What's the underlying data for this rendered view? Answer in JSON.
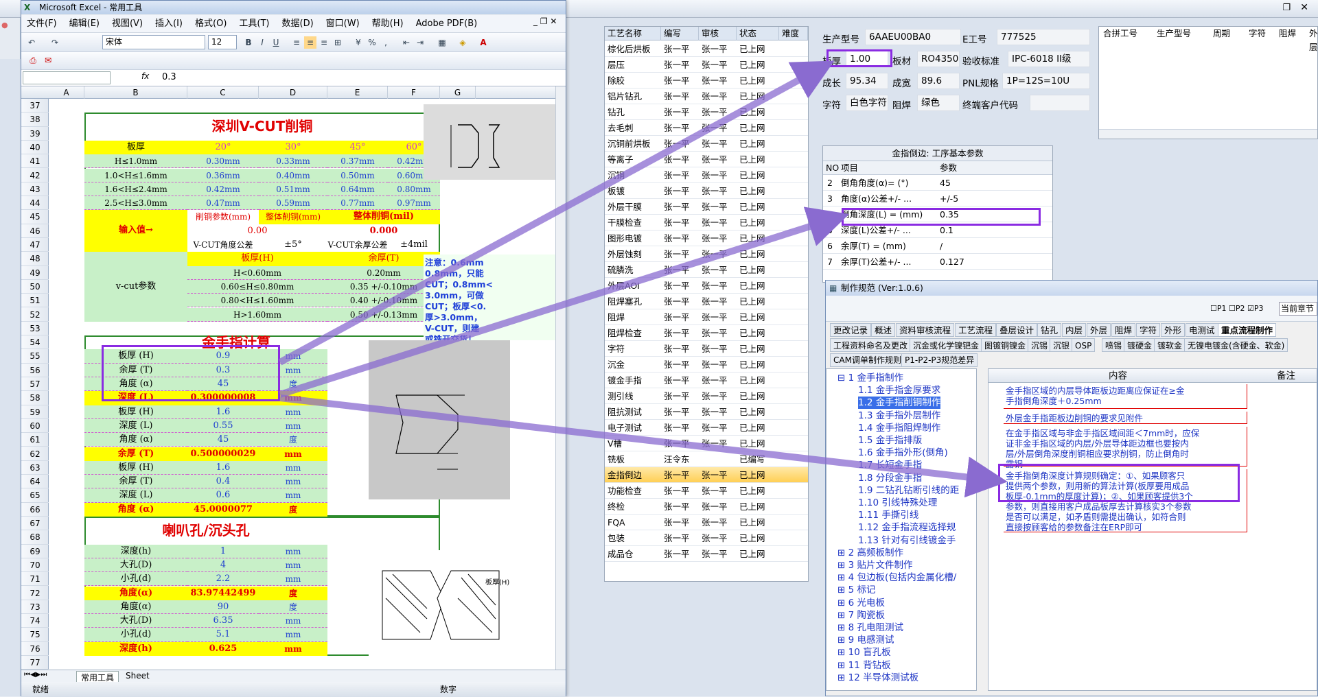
{
  "excel": {
    "title": "Microsoft Excel - 常用工具",
    "menus": [
      "文件(F)",
      "编辑(E)",
      "视图(V)",
      "插入(I)",
      "格式(O)",
      "工具(T)",
      "数据(D)",
      "窗口(W)",
      "帮助(H)",
      "Adobe PDF(B)"
    ],
    "font": "宋体",
    "font_size": "12",
    "fx": "fx",
    "formula_value": "0.3",
    "columns": [
      "A",
      "B",
      "C",
      "D",
      "E",
      "F",
      "G"
    ],
    "rows": [
      "37",
      "38",
      "39",
      "40",
      "41",
      "42",
      "43",
      "44",
      "45",
      "46",
      "47",
      "48",
      "49",
      "50",
      "51",
      "52",
      "53",
      "54",
      "55",
      "56",
      "57",
      "58",
      "59",
      "60",
      "61",
      "62",
      "63",
      "64",
      "65",
      "66",
      "67",
      "68",
      "69",
      "70",
      "71",
      "72",
      "73",
      "74",
      "75",
      "76",
      "77"
    ],
    "vcut": {
      "title": "深圳V-CUT削铜",
      "header": [
        "板厚",
        "20°",
        "30°",
        "45°",
        "60°"
      ],
      "rows": [
        [
          "H≤1.0mm",
          "0.30mm",
          "0.33mm",
          "0.37mm",
          "0.42mm"
        ],
        [
          "1.0<H≤1.6mm",
          "0.36mm",
          "0.40mm",
          "0.50mm",
          "0.60mm"
        ],
        [
          "1.6<H≤2.4mm",
          "0.42mm",
          "0.51mm",
          "0.64mm",
          "0.80mm"
        ],
        [
          "2.5<H≤3.0mm",
          "0.47mm",
          "0.59mm",
          "0.77mm",
          "0.97mm"
        ]
      ],
      "input_label": "输入值→",
      "param_hdr1": "削铜参数(mm)",
      "param_hdr2": "整体削铜(mm)",
      "param_hdr3": "整体削铜(mil)",
      "v1": "0.00",
      "v2": "0.000",
      "tol_label1": "V-CUT角度公差",
      "tol_value1": "±5°",
      "tol_label2": "V-CUT余厚公差",
      "tol_value2": "±4mil",
      "vcut_param_label": "v-cut参数",
      "vp_hdr1": "板厚(H)",
      "vp_hdr2": "余厚(T)",
      "vp_rows": [
        [
          "H<0.60mm",
          "0.20mm"
        ],
        [
          "0.60≤H≤0.80mm",
          "0.35 +/-0.10mm"
        ],
        [
          "0.80<H≤1.60mm",
          "0.40 +/-0.10mm"
        ],
        [
          "H>1.60mm",
          "0.50 +/-0.13mm"
        ]
      ],
      "note": "注意：0.6mm\n0.8mm，只能\nCUT；0.8mm<\n3.0mm，可做\nCUT；板厚<0.\n厚>3.0mm，\nV-CUT，则建\n或铣开交货！"
    },
    "gold": {
      "title": "金手指计算",
      "rows": [
        [
          "板厚 (H)",
          "0.9",
          "mm"
        ],
        [
          "余厚 (T)",
          "0.3",
          "mm"
        ],
        [
          "角度 (α)",
          "45",
          "度"
        ],
        [
          "深度 (L)",
          "0.300000008",
          "mm"
        ],
        [
          "板厚 (H)",
          "1.6",
          "mm"
        ],
        [
          "深度 (L)",
          "0.55",
          "mm"
        ],
        [
          "角度 (α)",
          "45",
          "度"
        ],
        [
          "余厚 (T)",
          "0.500000029",
          "mm"
        ],
        [
          "板厚 (H)",
          "1.6",
          "mm"
        ],
        [
          "余厚 (T)",
          "0.4",
          "mm"
        ],
        [
          "深度 (L)",
          "0.6",
          "mm"
        ],
        [
          "角度 (α)",
          "45.0000077",
          "度"
        ]
      ]
    },
    "horn": {
      "title": "喇叭孔/沉头孔",
      "rows": [
        [
          "深度(h)",
          "1",
          "mm"
        ],
        [
          "大孔(D)",
          "4",
          "mm"
        ],
        [
          "小孔(d)",
          "2.2",
          "mm"
        ],
        [
          "角度(α)",
          "83.97442499",
          "度"
        ],
        [
          "角度(α)",
          "90",
          "度"
        ],
        [
          "大孔(D)",
          "6.35",
          "mm"
        ],
        [
          "小孔(d)",
          "5.1",
          "mm"
        ],
        [
          "深度(h)",
          "0.625",
          "mm"
        ]
      ],
      "diagram_label": "板厚(H)"
    },
    "sheet_tabs": [
      "常用工具",
      "Sheet"
    ],
    "status": "就绪",
    "status_right": "数字"
  },
  "process": {
    "headers": [
      "工艺名称",
      "编写",
      "审核",
      "状态",
      "难度"
    ],
    "rows": [
      [
        "棕化后烘板",
        "张一平",
        "张一平",
        "已上网"
      ],
      [
        "层压",
        "张一平",
        "张一平",
        "已上网"
      ],
      [
        "除胶",
        "张一平",
        "张一平",
        "已上网"
      ],
      [
        "铝片钻孔",
        "张一平",
        "张一平",
        "已上网"
      ],
      [
        "钻孔",
        "张一平",
        "张一平",
        "已上网"
      ],
      [
        "去毛刺",
        "张一平",
        "张一平",
        "已上网"
      ],
      [
        "沉铜前烘板",
        "张一平",
        "张一平",
        "已上网"
      ],
      [
        "等离子",
        "张一平",
        "张一平",
        "已上网"
      ],
      [
        "沉铜",
        "张一平",
        "张一平",
        "已上网"
      ],
      [
        "板镀",
        "张一平",
        "张一平",
        "已上网"
      ],
      [
        "外层干膜",
        "张一平",
        "张一平",
        "已上网"
      ],
      [
        "干膜检查",
        "张一平",
        "张一平",
        "已上网"
      ],
      [
        "图形电镀",
        "张一平",
        "张一平",
        "已上网"
      ],
      [
        "外层蚀刻",
        "张一平",
        "张一平",
        "已上网"
      ],
      [
        "硫膦洗",
        "张一平",
        "张一平",
        "已上网"
      ],
      [
        "外层AOI",
        "张一平",
        "张一平",
        "已上网"
      ],
      [
        "阻焊塞孔",
        "张一平",
        "张一平",
        "已上网"
      ],
      [
        "阻焊",
        "张一平",
        "张一平",
        "已上网"
      ],
      [
        "阻焊检查",
        "张一平",
        "张一平",
        "已上网"
      ],
      [
        "字符",
        "张一平",
        "张一平",
        "已上网"
      ],
      [
        "沉金",
        "张一平",
        "张一平",
        "已上网"
      ],
      [
        "镀金手指",
        "张一平",
        "张一平",
        "已上网"
      ],
      [
        "测引线",
        "张一平",
        "张一平",
        "已上网"
      ],
      [
        "阻抗测试",
        "张一平",
        "张一平",
        "已上网"
      ],
      [
        "电子测试",
        "张一平",
        "张一平",
        "已上网"
      ],
      [
        "V槽",
        "张一平",
        "张一平",
        "已上网"
      ],
      [
        "铣板",
        "汪令东",
        "",
        "已编写"
      ],
      [
        "金指倒边",
        "张一平",
        "张一平",
        "已上网"
      ],
      [
        "功能检查",
        "张一平",
        "张一平",
        "已上网"
      ],
      [
        "终检",
        "张一平",
        "张一平",
        "已上网"
      ],
      [
        "FQA",
        "张一平",
        "张一平",
        "已上网"
      ],
      [
        "包装",
        "张一平",
        "张一平",
        "已上网"
      ],
      [
        "成品仓",
        "张一平",
        "张一平",
        "已上网"
      ]
    ],
    "selected_index": 27
  },
  "info": {
    "model_label": "生产型号",
    "model_value": "6AAEU00BA0",
    "eno_label": "E工号",
    "eno_value": "777525",
    "thick_label": "板厚",
    "thick_value": "1.00",
    "mat_label": "板材",
    "mat_value": "RO4350B",
    "std_label": "验收标准",
    "std_value": "IPC-6018 II级",
    "len_label": "成长",
    "len_value": "95.34",
    "wid_label": "成宽",
    "wid_value": "89.6",
    "pnl_label": "PNL规格",
    "pnl_value": "1P=12S=10U",
    "char_label": "字符",
    "char_value": "白色字符",
    "mask_label": "阻焊",
    "mask_value": "绿色",
    "cust_label": "终端客户代码",
    "merge_headers": [
      "合拼工号",
      "生产型号",
      "周期",
      "字符",
      "阻焊",
      "外层"
    ]
  },
  "params": {
    "title": "金指倒边: 工序基本参数",
    "headers": [
      "NO",
      "项目",
      "参数"
    ],
    "rows": [
      [
        "2",
        "倒角角度(α)= (°)",
        "45"
      ],
      [
        "3",
        "角度(α)公差+/- ...",
        "+/-5"
      ],
      [
        "4",
        "倒角深度(L) = (mm)",
        "0.35"
      ],
      [
        "5",
        "深度(L)公差+/- ...",
        "0.1"
      ],
      [
        "6",
        "余厚(T) = (mm)",
        "/"
      ],
      [
        "7",
        "余厚(T)公差+/- ...",
        "0.127"
      ]
    ]
  },
  "spec": {
    "title": "制作规范 (Ver:1.0.6)",
    "p_checks": [
      "P1",
      "P2",
      "P3"
    ],
    "chapter": "当前章节",
    "tabs1": [
      "更改记录",
      "概述",
      "资料审核流程",
      "工艺流程",
      "叠层设计",
      "钻孔",
      "内层",
      "外层",
      "阻焊",
      "字符",
      "外形",
      "电测试",
      "重点流程制作"
    ],
    "tabs2": [
      "工程资料命名及更改",
      "沉金或化学镍钯金",
      "图镀铜镍金",
      "沉锡",
      "沉银",
      "OSP",
      "喷锡",
      "镀硬金",
      "镀软金",
      "无镍电镀金(含硬金、软金)"
    ],
    "tabs3": [
      "CAM调单制作规则",
      "P1-P2-P3规范差异"
    ],
    "tree": [
      "⊟ 1 金手指制作",
      "1.1 金手指金厚要求",
      "1.2 金手指削铜制作",
      "1.3 金手指外层制作",
      "1.4 金手指阻焊制作",
      "1.5 金手指排版",
      "1.6 金手指外形(倒角)",
      "1.7 长短金手指",
      "1.8 分段金手指",
      "1.9 二钻孔钻断引线的距",
      "1.10 引线特殊处理",
      "1.11 手撕引线",
      "1.12 金手指流程选择规",
      "1.13 针对有引线镀金手",
      "⊞ 2 高频板制作",
      "⊞ 3 贴片文件制作",
      "⊞ 4 包边板(包括内金属化槽/",
      "⊞ 5 标记",
      "⊞ 6 光电板",
      "⊞ 7 陶瓷板",
      "⊞ 8 孔电阻测试",
      "⊞ 9 电感测试",
      "⊞ 10 盲孔板",
      "⊞ 11 背钻板",
      "⊞ 12 半导体测试板"
    ],
    "content_headers": [
      "内容",
      "备注"
    ],
    "content_rows": [
      "金手指区域的内层导体距板边距离应保证在≥金\n手指倒角深度＋0.25mm",
      "外层金手指距板边削铜的要求见附件",
      "在金手指区域与非金手指区域间距＜7mm时，应保\n证非金手指区域的内层/外层导体距边框也要按内\n层/外层倒角深度削铜相应要求削铜，防止倒角时\n露铜",
      "金手指倒角深度计算规则确定：①、如果顾客只\n提供两个参数，则用新的算法计算(板厚要用成品\n板厚-0.1mm的厚度计算)；②、如果顾客提供3个\n参数，则直接用客户成品板厚去计算核实3个参数\n是否可以满足，如矛盾则需提出确认，如符合则\n直接按顾客给的参数备注在ERP即可"
    ]
  },
  "colors": {
    "highlight": "#8a2be2",
    "arrow": "#8a6bd0",
    "green_fill": "#c8f0c8",
    "yellow_fill": "#ffff00",
    "red_text": "#e00000",
    "blue_text": "#1f3fd0"
  }
}
